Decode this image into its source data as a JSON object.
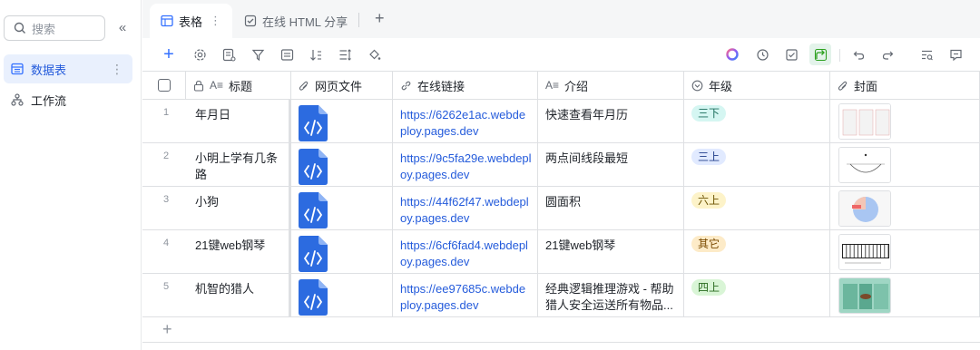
{
  "sidebar": {
    "search_placeholder": "搜索",
    "items": [
      {
        "label": "数据表",
        "icon": "table-icon",
        "active": true
      },
      {
        "label": "工作流",
        "icon": "workflow-icon",
        "active": false
      }
    ]
  },
  "tabs": [
    {
      "label": "表格",
      "icon": "table-icon",
      "active": true
    },
    {
      "label": "在线 HTML 分享",
      "icon": "checkbox-icon",
      "active": false
    }
  ],
  "columns": [
    {
      "label": "标题",
      "icon": "text-icon"
    },
    {
      "label": "网页文件",
      "icon": "attachment-icon"
    },
    {
      "label": "在线链接",
      "icon": "link-icon"
    },
    {
      "label": "介绍",
      "icon": "text-icon"
    },
    {
      "label": "年级",
      "icon": "select-icon"
    },
    {
      "label": "封面",
      "icon": "attachment-icon"
    }
  ],
  "rows": [
    {
      "num": "1",
      "title": "年月日",
      "link": "https://6262e1ac.webdeploy.pages.dev",
      "intro": "快速查看年月历",
      "grade": "三下",
      "grade_color": "#d5f6f2",
      "grade_text": "#1a6d5c"
    },
    {
      "num": "2",
      "title": "小明上学有几条路",
      "link": "https://9c5fa29e.webdeploy.pages.dev",
      "intro": "两点间线段最短",
      "grade": "三上",
      "grade_color": "#e1eaff",
      "grade_text": "#1f3d8a"
    },
    {
      "num": "3",
      "title": "小狗",
      "link": "https://44f62f47.webdeploy.pages.dev",
      "intro": "圆面积",
      "grade": "六上",
      "grade_color": "#fdf3c9",
      "grade_text": "#6b5200"
    },
    {
      "num": "4",
      "title": "21键web钢琴",
      "link": "https://6cf6fad4.webdeploy.pages.dev",
      "intro": "21键web钢琴",
      "grade": "其它",
      "grade_color": "#fdebc8",
      "grade_text": "#7a4a00"
    },
    {
      "num": "5",
      "title": "机智的猎人",
      "link": "https://ee97685c.webdeploy.pages.dev",
      "intro": "经典逻辑推理游戏 - 帮助猎人安全运送所有物品...",
      "grade": "四上",
      "grade_color": "#d9f5d6",
      "grade_text": "#2a6b20"
    }
  ],
  "colors": {
    "accent": "#3370ff",
    "file_icon": "#2c6be0",
    "link": "#245bdb"
  }
}
